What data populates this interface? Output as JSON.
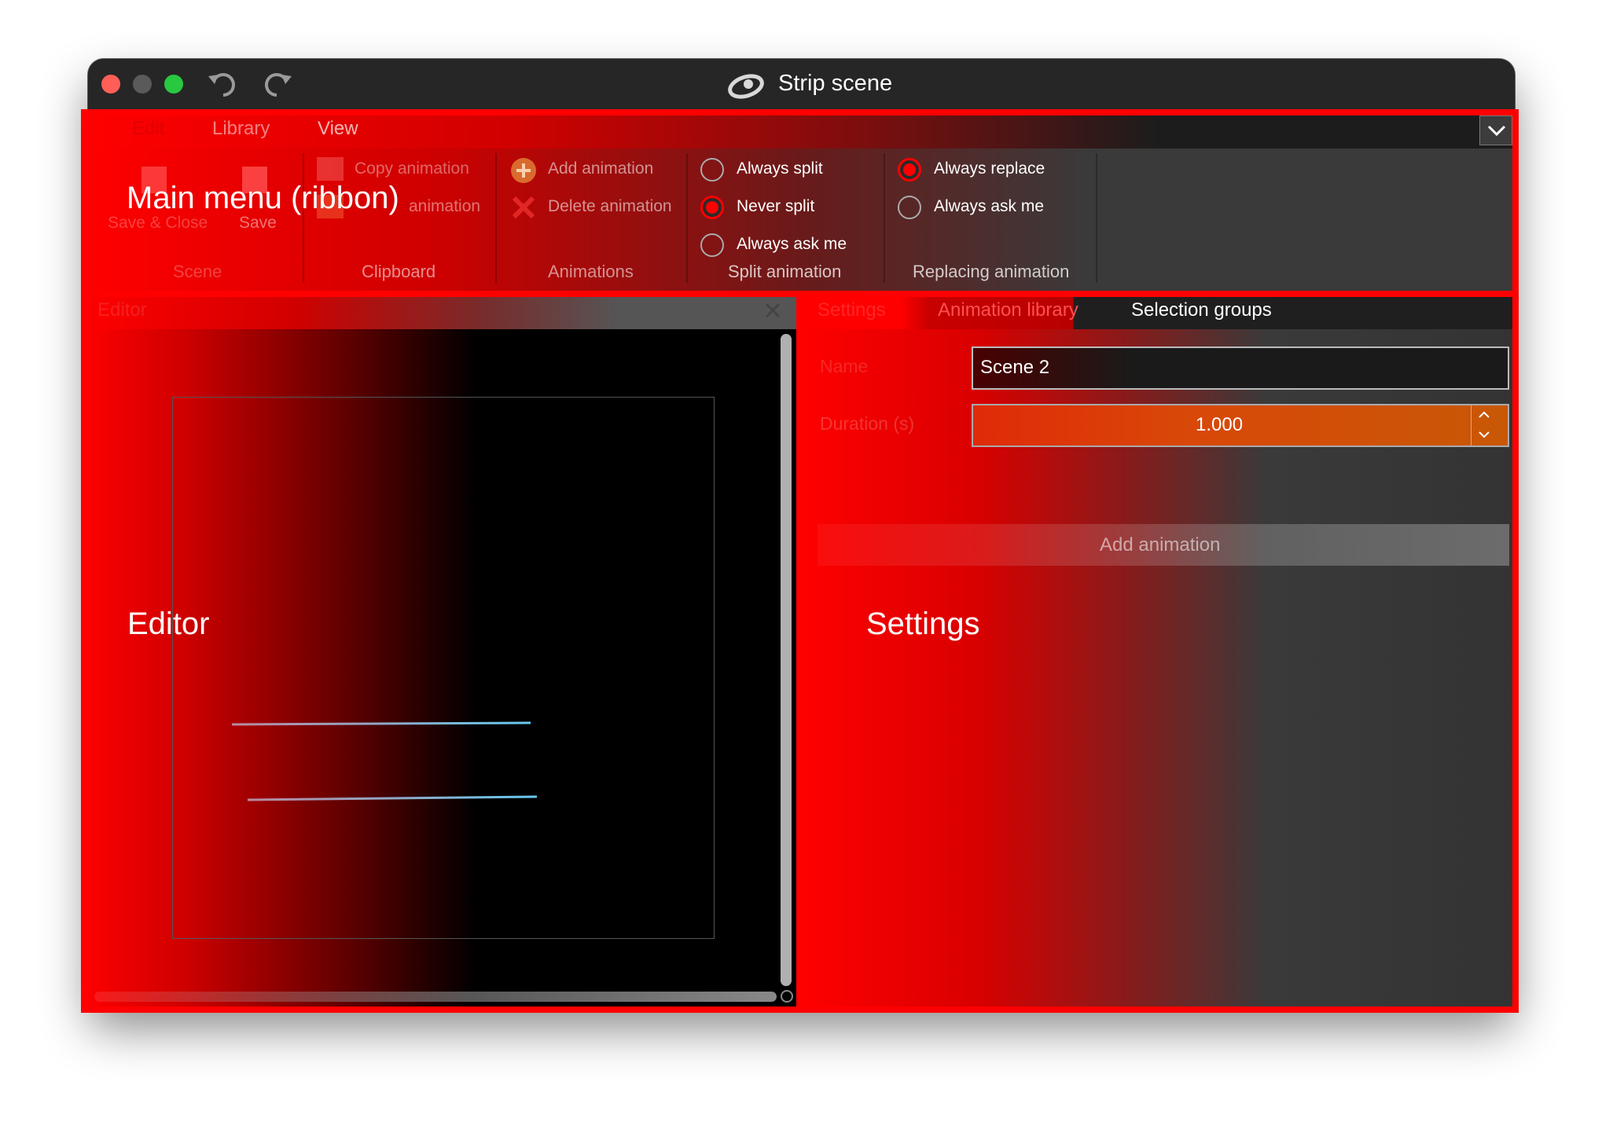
{
  "window": {
    "title": "Strip scene",
    "colors": {
      "accent": "#ff0000",
      "orange": "#e05a10",
      "bg": "#2b2b2b"
    }
  },
  "menubar": {
    "tabs": [
      "Edit",
      "Library",
      "View"
    ]
  },
  "ribbon": {
    "scene": {
      "group_label": "Scene",
      "save_close": "Save & Close",
      "save": "Save"
    },
    "clipboard": {
      "group_label": "Clipboard",
      "copy": "Copy animation",
      "paste": "animation"
    },
    "animations": {
      "group_label": "Animations",
      "add": "Add animation",
      "delete": "Delete animation"
    },
    "split": {
      "group_label": "Split animation",
      "always_split": "Always split",
      "never_split": "Never split",
      "always_ask": "Always ask me",
      "selected": "Never split"
    },
    "replacing": {
      "group_label": "Replacing animation",
      "always_replace": "Always replace",
      "always_ask": "Always ask me",
      "selected": "Always replace"
    }
  },
  "editor": {
    "header": "Editor"
  },
  "settings_panel": {
    "tabs": [
      "Settings",
      "Animation library",
      "Selection groups"
    ],
    "name_label": "Name",
    "name_value": "Scene 2",
    "duration_label": "Duration (s)",
    "duration_value": "1.000",
    "add_animation": "Add animation"
  },
  "annotations": {
    "ribbon": "Main menu (ribbon)",
    "editor": "Editor",
    "settings": "Settings"
  }
}
